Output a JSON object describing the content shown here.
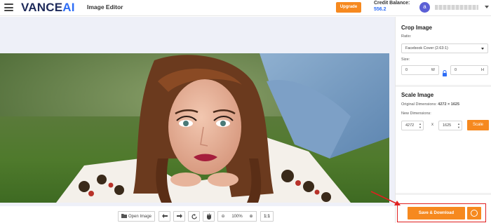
{
  "header": {
    "logo_main": "VANCE",
    "logo_accent": "AI",
    "app_title": "Image Editor",
    "upgrade_label": "Upgrade",
    "credit_label": "Credit Balance:",
    "credit_value": "556.2",
    "avatar_letter": "a"
  },
  "toolbar": {
    "open_image_label": "Open Image",
    "zoom_level": "100%",
    "actual_size_label": "1:1",
    "zoom_out_symbol": "⊖",
    "zoom_in_symbol": "⊕"
  },
  "crop": {
    "title": "Crop Image",
    "ratio_label": "Ratio:",
    "ratio_value": "Facebook Cover (2.63:1)",
    "size_label": "Size:",
    "width_value": "0",
    "width_unit": "W",
    "height_value": "0",
    "height_unit": "H"
  },
  "scale": {
    "title": "Scale Image",
    "original_label": "Original Dimensions:",
    "original_value": "4272 × 1625",
    "new_label": "New Dimensions:",
    "new_width": "4272",
    "times": "x",
    "new_height": "1625",
    "button_label": "Scale"
  },
  "save": {
    "label": "Save & Download"
  },
  "colors": {
    "accent_orange": "#f6891f",
    "brand_blue": "#2d6df6",
    "brand_dark": "#1e2a5a",
    "highlight_red": "#e02020"
  }
}
